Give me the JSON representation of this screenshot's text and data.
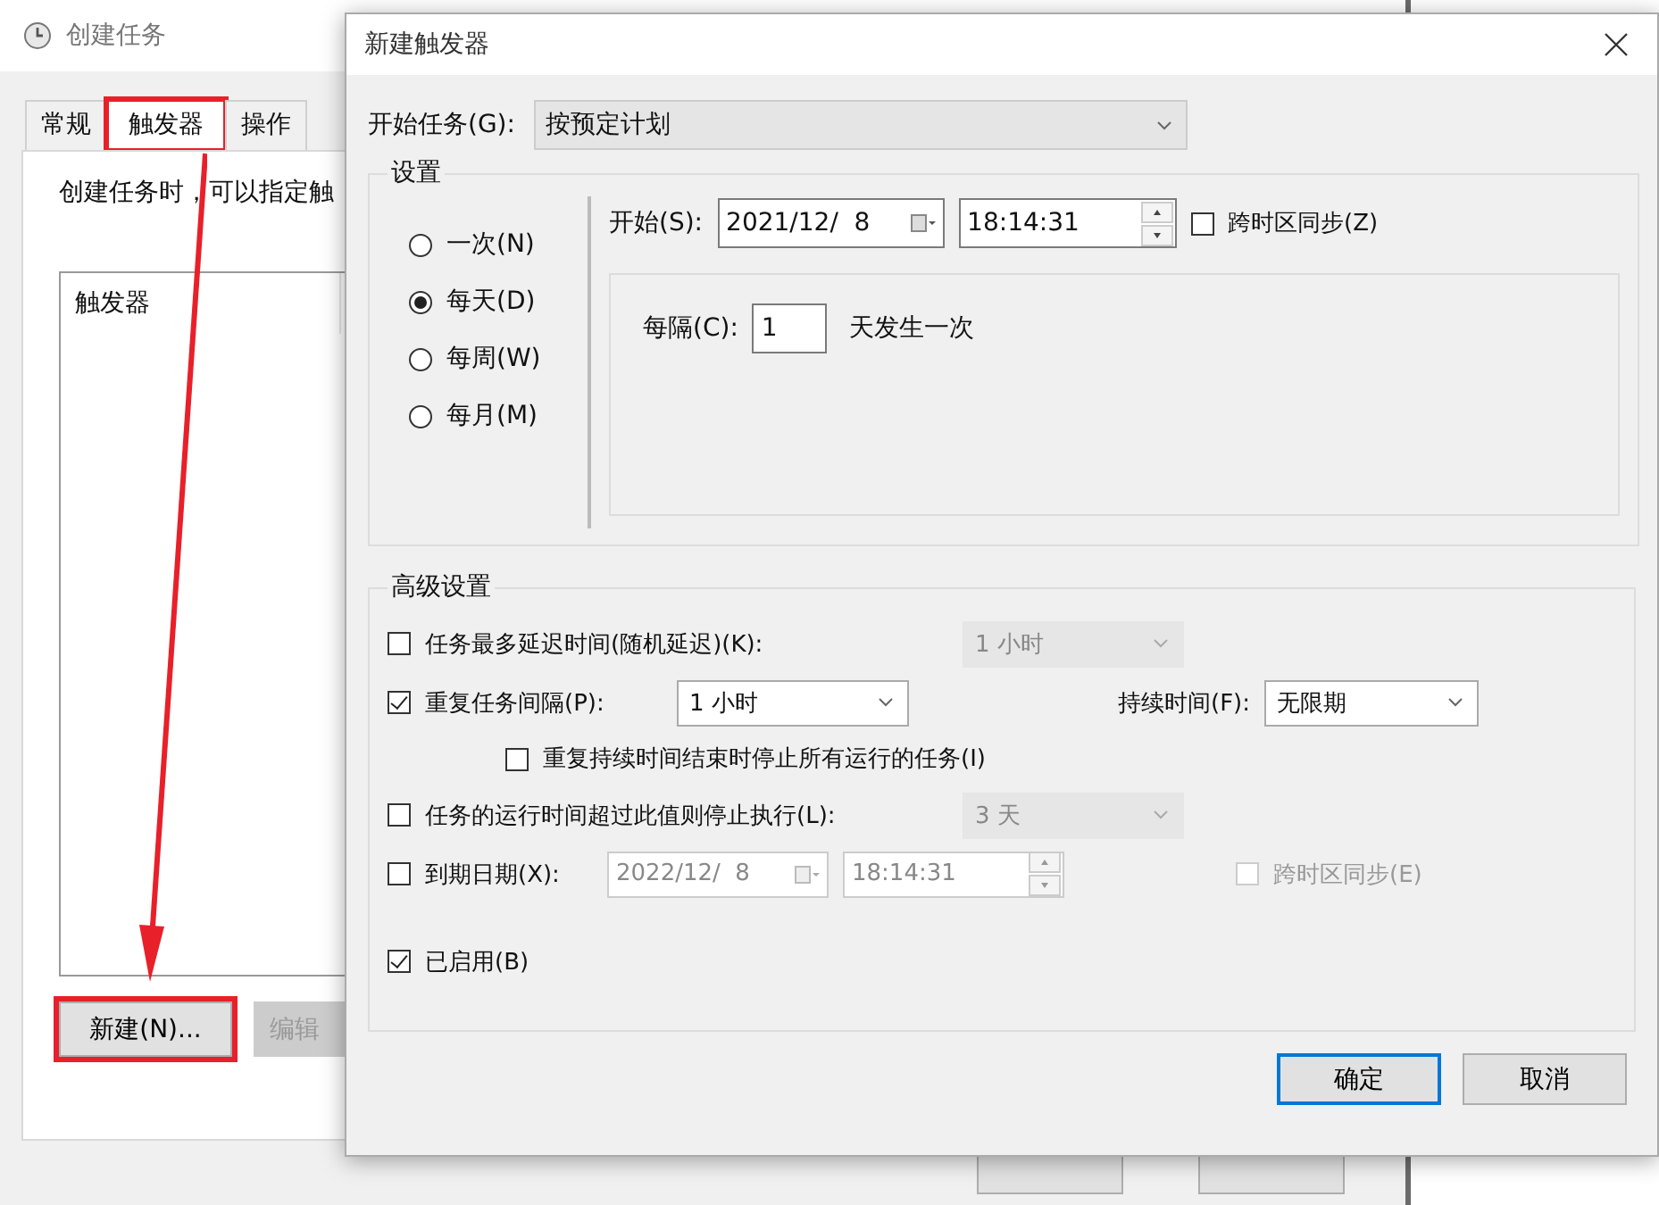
{
  "back_window": {
    "title": "创建任务",
    "tabs": [
      {
        "label": "常规",
        "selected": false,
        "highlighted": false
      },
      {
        "label": "触发器",
        "selected": true,
        "highlighted": true
      },
      {
        "label": "操作",
        "selected": false,
        "highlighted": false
      }
    ],
    "description": "创建任务时，可以指定触",
    "list_header": "触发器",
    "buttons": [
      {
        "label": "新建(N)...",
        "disabled": false,
        "highlighted": true
      },
      {
        "label": "编辑",
        "disabled": true,
        "highlighted": false
      }
    ]
  },
  "dialog": {
    "title": "新建触发器",
    "begin_label": "开始任务(G):",
    "begin_value": "按预定计划",
    "settings": {
      "title": "设置",
      "schedule": [
        {
          "label": "一次(N)",
          "selected": false
        },
        {
          "label": "每天(D)",
          "selected": true
        },
        {
          "label": "每周(W)",
          "selected": false
        },
        {
          "label": "每月(M)",
          "selected": false
        }
      ],
      "start_label": "开始(S):",
      "start_date": "2021/12/  8",
      "start_time": "18:14:31",
      "sync": {
        "label": "跨时区同步(Z)",
        "checked": false
      },
      "interval_label": "每隔(C):",
      "interval_value": "1",
      "interval_unit": "天发生一次"
    },
    "advanced": {
      "title": "高级设置",
      "delay": {
        "label": "任务最多延迟时间(随机延迟)(K):",
        "checked": false,
        "value": "1 小时"
      },
      "repeat": {
        "label": "重复任务间隔(P):",
        "checked": true,
        "value": "1 小时",
        "duration_label": "持续时间(F):",
        "duration_value": "无限期"
      },
      "stop_all": {
        "label": "重复持续时间结束时停止所有运行的任务(I)",
        "checked": false
      },
      "stop_after": {
        "label": "任务的运行时间超过此值则停止执行(L):",
        "checked": false,
        "value": "3 天"
      },
      "expire": {
        "label": "到期日期(X):",
        "checked": false,
        "date": "2022/12/  8",
        "time": "18:14:31",
        "sync": {
          "label": "跨时区同步(E)",
          "checked": false
        }
      },
      "enabled": {
        "label": "已启用(B)",
        "checked": true
      }
    },
    "buttons": [
      {
        "label": "确定",
        "default": true
      },
      {
        "label": "取消",
        "default": false
      }
    ]
  }
}
